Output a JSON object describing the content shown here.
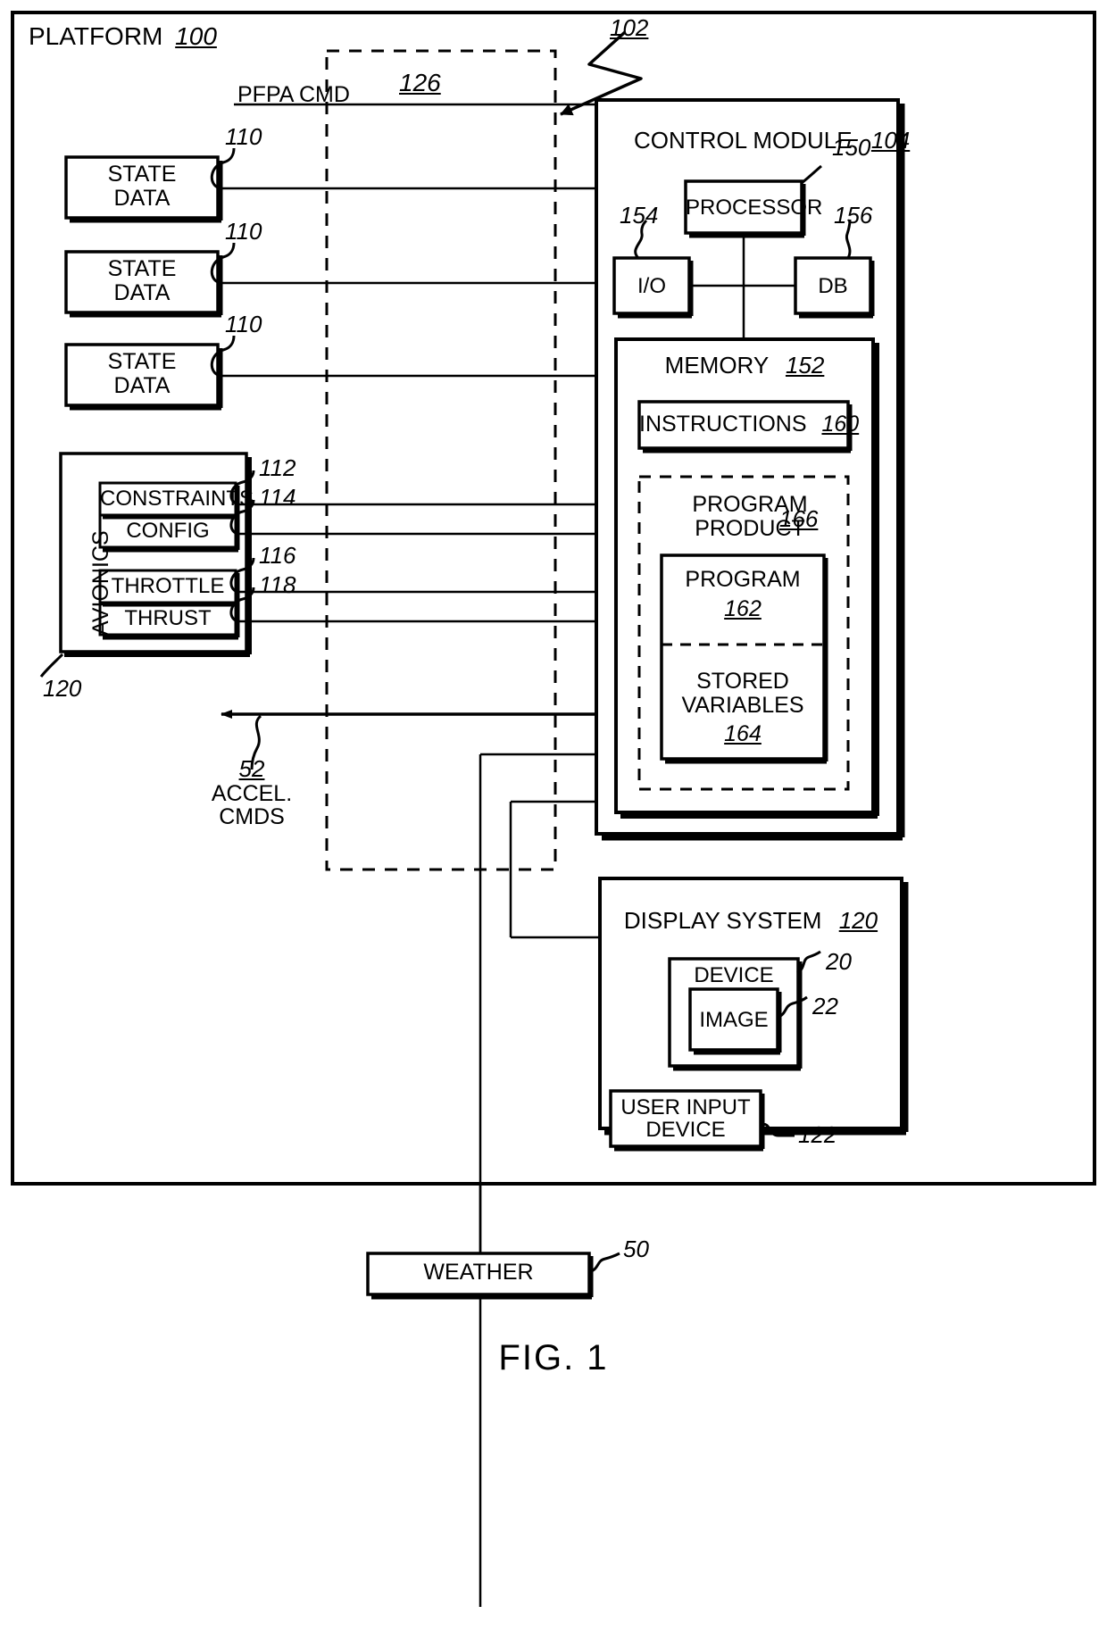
{
  "figure": {
    "caption": "FIG. 1",
    "platform_label": "PLATFORM",
    "platform_ref": "100",
    "dashed_region_ref": "126",
    "pfpa_cmd_label": "PFPA CMD",
    "leader_102": "102"
  },
  "state_data_blocks": [
    {
      "label_line1": "STATE",
      "label_line2": "DATA",
      "ref": "110"
    },
    {
      "label_line1": "STATE",
      "label_line2": "DATA",
      "ref": "110"
    },
    {
      "label_line1": "STATE",
      "label_line2": "DATA",
      "ref": "110"
    }
  ],
  "avionics": {
    "title": "AVIONICS",
    "ref": "120",
    "items": [
      {
        "label": "CONSTRAINTS",
        "ref": "112"
      },
      {
        "label": "CONFIG",
        "ref": "114"
      },
      {
        "label": "THROTTLE",
        "ref": "116"
      },
      {
        "label": "THRUST",
        "ref": "118"
      }
    ]
  },
  "accel": {
    "ref": "52",
    "line1": "ACCEL.",
    "line2": "CMDS"
  },
  "control_module": {
    "title": "CONTROL MODULE",
    "ref": "104",
    "processor": {
      "label": "PROCESSOR",
      "ref": "150"
    },
    "io": {
      "label": "I/O",
      "ref": "154"
    },
    "db": {
      "label": "DB",
      "ref": "156"
    },
    "memory": {
      "title": "MEMORY",
      "ref": "152",
      "instructions": {
        "label": "INSTRUCTIONS",
        "ref": "160"
      },
      "program_product": {
        "title_line1": "PROGRAM",
        "title_line2": "PRODUCT",
        "ref": "166",
        "program": {
          "label": "PROGRAM",
          "ref": "162"
        },
        "stored_variables": {
          "label_line1": "STORED",
          "label_line2": "VARIABLES",
          "ref": "164"
        }
      }
    }
  },
  "display_system": {
    "title": "DISPLAY SYSTEM",
    "ref": "120",
    "device": {
      "label": "DEVICE",
      "ref": "20"
    },
    "image": {
      "label": "IMAGE",
      "ref": "22"
    },
    "user_input_device": {
      "label_line1": "USER INPUT",
      "label_line2": "DEVICE",
      "ref": "122"
    }
  },
  "weather": {
    "label": "WEATHER",
    "ref": "50"
  },
  "colors": {
    "line": "#000000",
    "background": "#ffffff"
  }
}
